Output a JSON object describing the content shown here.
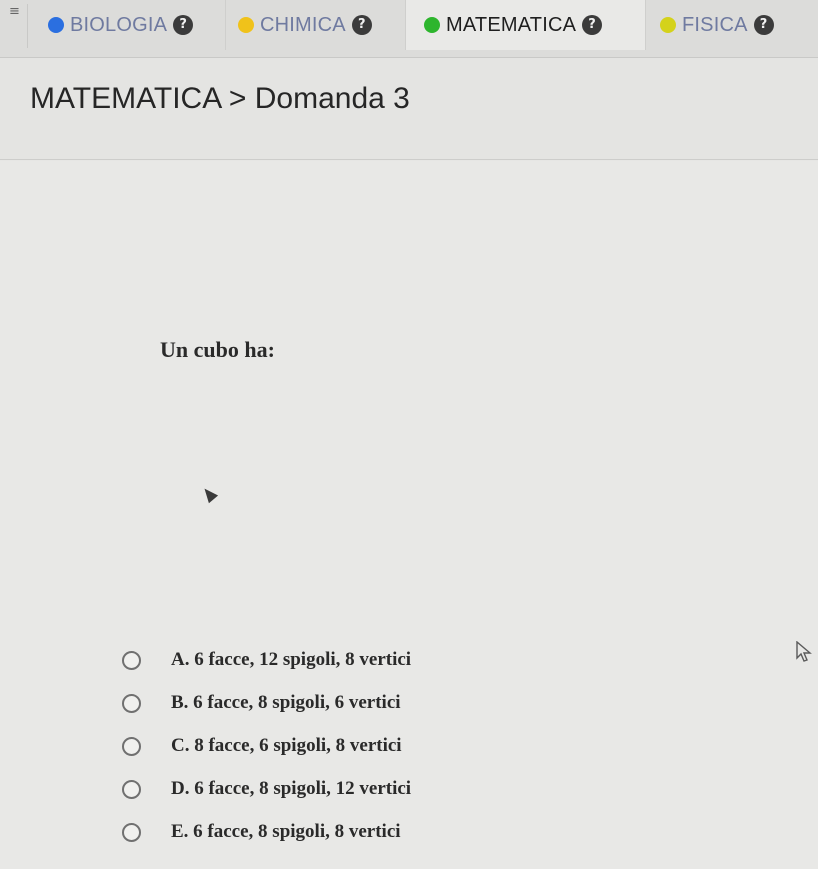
{
  "tabbar": {
    "menu_icon": "≡",
    "tabs": [
      {
        "label": "BIOLOGIA",
        "color": "#2b6fe0",
        "help": "?"
      },
      {
        "label": "CHIMICA",
        "color": "#f0c21a",
        "help": "?"
      },
      {
        "label": "MATEMATICA",
        "color": "#2db52d",
        "help": "?"
      },
      {
        "label": "FISICA",
        "color": "#d4d21b",
        "help": "?"
      }
    ]
  },
  "header": {
    "breadcrumb": "MATEMATICA > Domanda 3"
  },
  "question": {
    "text": "Un cubo ha:",
    "options": [
      {
        "label": "A. 6 facce, 12 spigoli, 8 vertici"
      },
      {
        "label": "B. 6 facce, 8 spigoli, 6 vertici"
      },
      {
        "label": "C. 8 facce, 6 spigoli, 8 vertici"
      },
      {
        "label": "D. 6 facce, 8 spigoli, 12 vertici"
      },
      {
        "label": "E. 6 facce, 8 spigoli, 8 vertici"
      }
    ]
  }
}
